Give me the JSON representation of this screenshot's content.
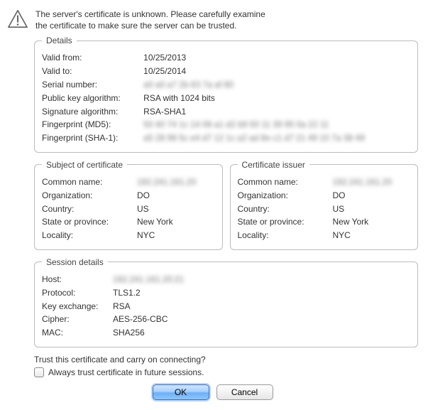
{
  "warning": {
    "line1": "The server's certificate is unknown. Please carefully examine",
    "line2": "the certificate to make sure the server can be trusted."
  },
  "details": {
    "legend": "Details",
    "rows": {
      "valid_from_label": "Valid from:",
      "valid_from_value": "10/25/2013",
      "valid_to_label": "Valid to:",
      "valid_to_value": "10/25/2014",
      "serial_label": "Serial number:",
      "serial_value": "a0 a0 a7 2b 63 7a af 80",
      "pubkey_label": "Public key algorithm:",
      "pubkey_value": "RSA with 1024 bits",
      "sigalg_label": "Signature algorithm:",
      "sigalg_value": "RSA-SHA1",
      "fp_md5_label": "Fingerprint (MD5):",
      "fp_md5_value": "50 40 74 1c 14 08 a1 d2 b9 50 11 39 95 0a 22 11",
      "fp_sha1_label": "Fingerprint (SHA-1):",
      "fp_sha1_value": "a5 28 98 5c e4 d7 12 1c a2 ad 8e c1 d7 21 49 10 7a 38 49"
    }
  },
  "subject": {
    "legend": "Subject of certificate",
    "common_name_label": "Common name:",
    "common_name_value": "192.241.161.20",
    "organization_label": "Organization:",
    "organization_value": "DO",
    "country_label": "Country:",
    "country_value": "US",
    "state_label": "State or province:",
    "state_value": "New York",
    "locality_label": "Locality:",
    "locality_value": "NYC"
  },
  "issuer": {
    "legend": "Certificate issuer",
    "common_name_label": "Common name:",
    "common_name_value": "192.241.161.20",
    "organization_label": "Organization:",
    "organization_value": "DO",
    "country_label": "Country:",
    "country_value": "US",
    "state_label": "State or province:",
    "state_value": "New York",
    "locality_label": "Locality:",
    "locality_value": "NYC"
  },
  "session": {
    "legend": "Session details",
    "host_label": "Host:",
    "host_value": "192.241.161.20:21",
    "protocol_label": "Protocol:",
    "protocol_value": "TLS1.2",
    "kex_label": "Key exchange:",
    "kex_value": "RSA",
    "cipher_label": "Cipher:",
    "cipher_value": "AES-256-CBC",
    "mac_label": "MAC:",
    "mac_value": "SHA256"
  },
  "footer": {
    "question": "Trust this certificate and carry on connecting?",
    "checkbox_label": "Always trust certificate in future sessions.",
    "ok": "OK",
    "cancel": "Cancel"
  }
}
